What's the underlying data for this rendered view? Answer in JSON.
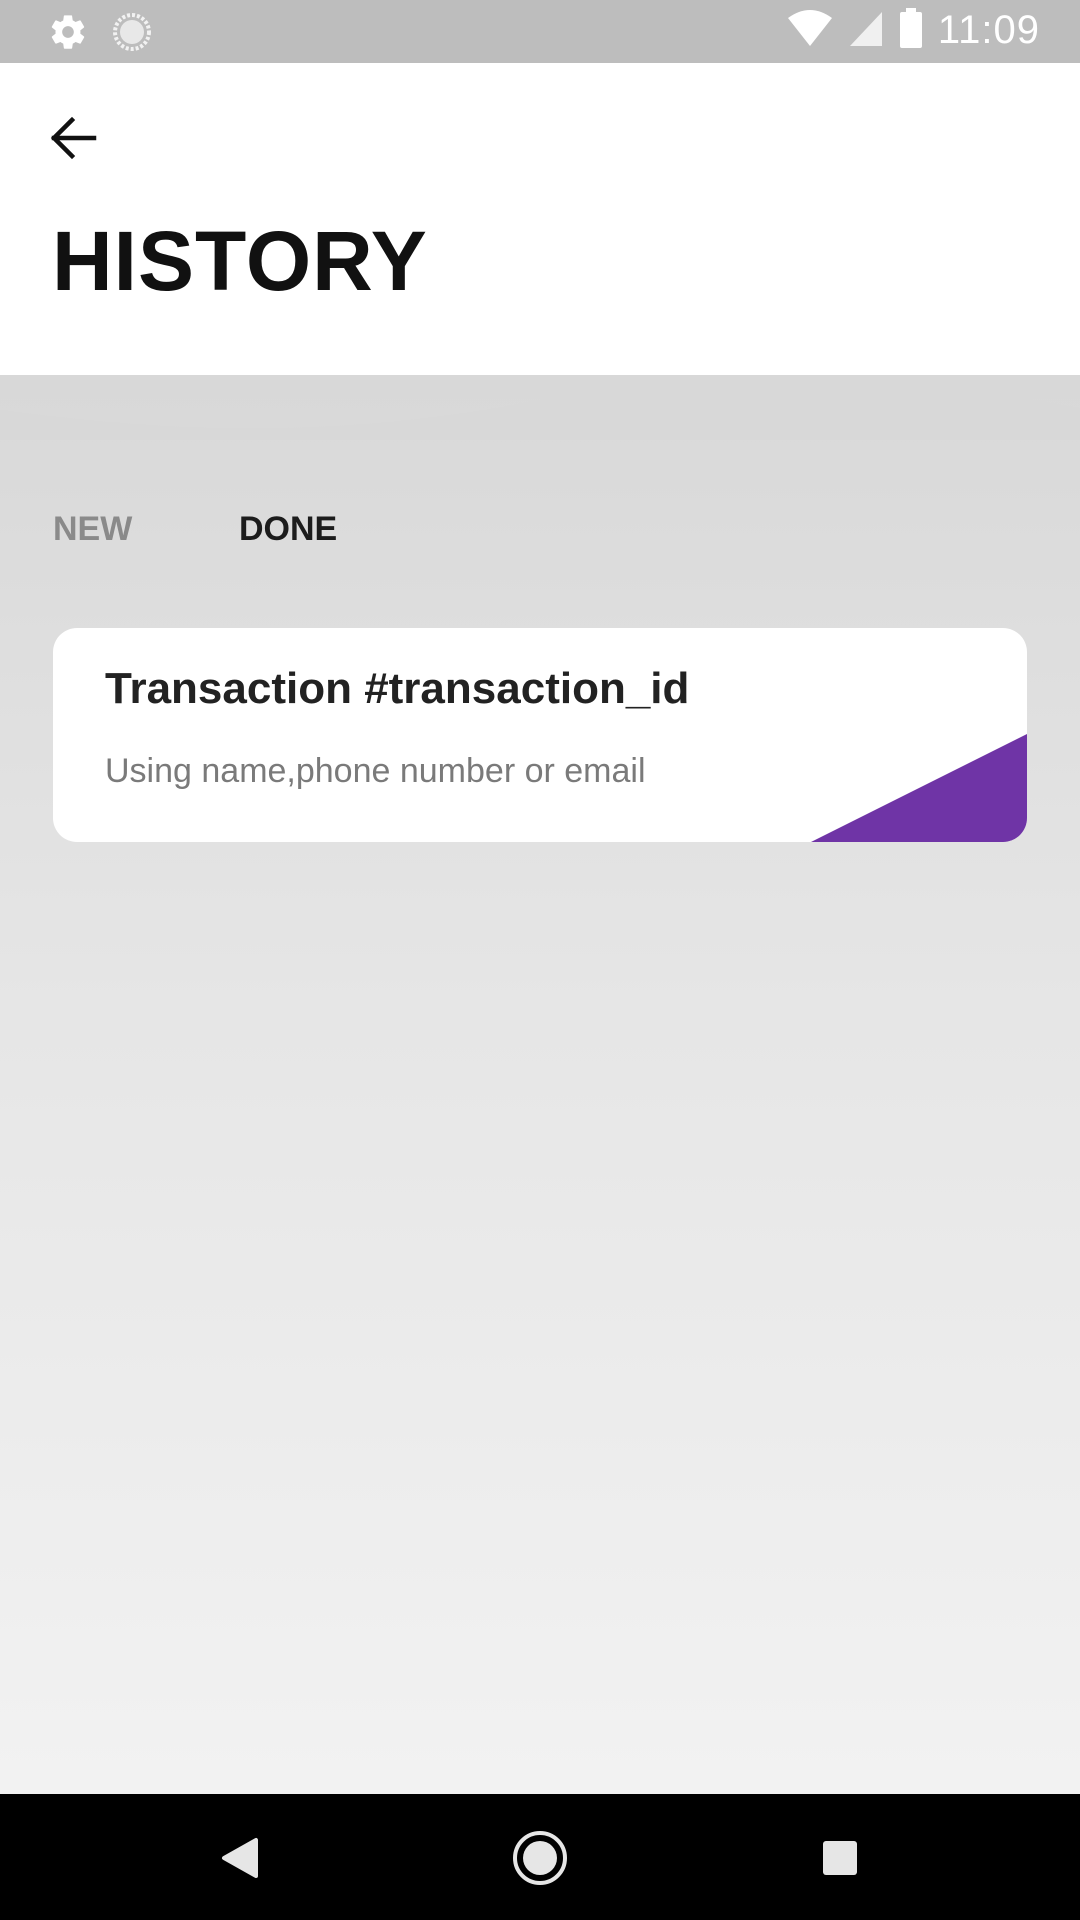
{
  "status_bar": {
    "time": "11:09",
    "icons": [
      "gear-icon",
      "sync-icon",
      "wifi-icon",
      "signal-icon",
      "battery-icon"
    ]
  },
  "header": {
    "back_icon": "arrow-left-icon",
    "title": "HISTORY"
  },
  "tabs": [
    {
      "label": "NEW",
      "active": false
    },
    {
      "label": "DONE",
      "active": true
    }
  ],
  "transactions": [
    {
      "title": "Transaction #transaction_id",
      "subtitle": "Using name,phone number or email",
      "accent_color": "#6f34a6"
    }
  ],
  "nav_bar": {
    "icons": [
      "back-triangle-icon",
      "home-circle-icon",
      "recents-square-icon"
    ]
  },
  "colors": {
    "status_bar": "#bdbdbd",
    "accent": "#6f34a6",
    "tab_inactive": "#8a8a8a",
    "tab_active": "#1c1c1c"
  }
}
